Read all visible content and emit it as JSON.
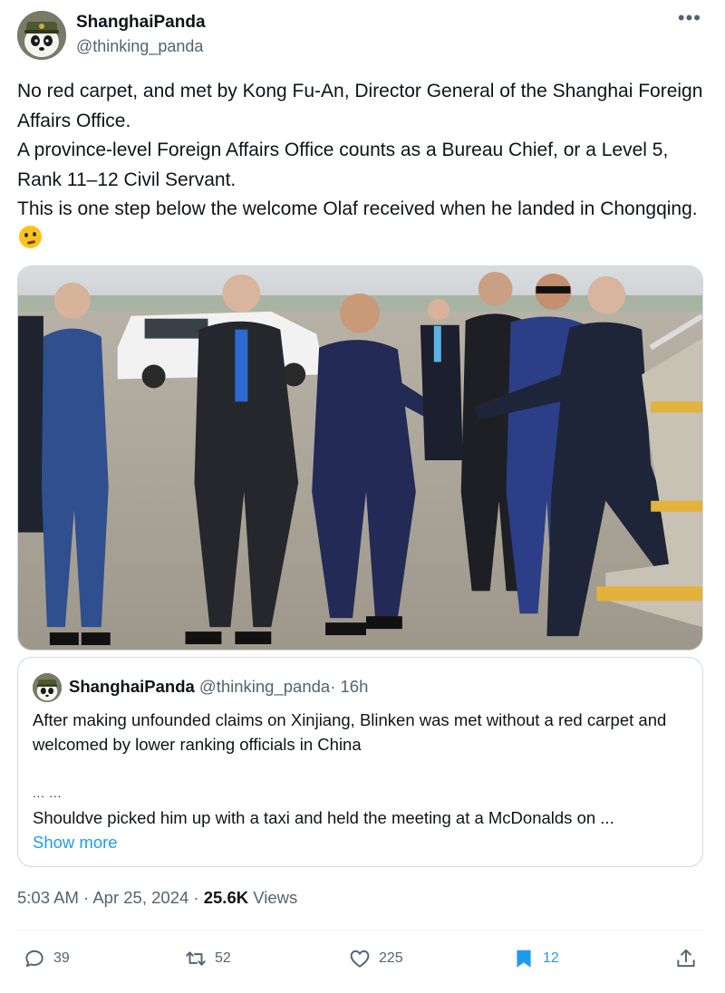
{
  "author": {
    "name": "ShanghaiPanda",
    "handle": "@thinking_panda"
  },
  "more_icon": "more-horizontal-icon",
  "tweet": {
    "lines": [
      "No red carpet, and met by Kong Fu-An, Director General of the Shanghai Foreign Affairs Office.",
      "A province-level Foreign Affairs Office counts as a Bureau Chief, or a Level 5, Rank 11–12 Civil Servant.",
      "This is one step below the welcome Olaf received when he landed in Chongqing."
    ],
    "emoji": "thinking-face-emoji"
  },
  "quote": {
    "name": "ShanghaiPanda",
    "handle": "@thinking_panda",
    "separator": "·",
    "time": "16h",
    "body_line1": "After making unfounded claims on Xinjiang, Blinken was met without a red carpet and welcomed by lower ranking officials in China",
    "ellipsis": "... ...",
    "body_line2": "Shouldve picked him up with a taxi and held the meeting at a McDonalds on ...",
    "show_more": "Show more"
  },
  "meta": {
    "time": "5:03 AM",
    "dot1": "·",
    "date": "Apr 25, 2024",
    "dot2": "·",
    "views_count": "25.6K",
    "views_label": "Views"
  },
  "actions": {
    "replies": "39",
    "retweets": "52",
    "likes": "225",
    "bookmarks": "12"
  },
  "colors": {
    "accent": "#1d9bf0",
    "muted": "#536471",
    "text": "#0f1419",
    "border": "#cfd9de"
  }
}
